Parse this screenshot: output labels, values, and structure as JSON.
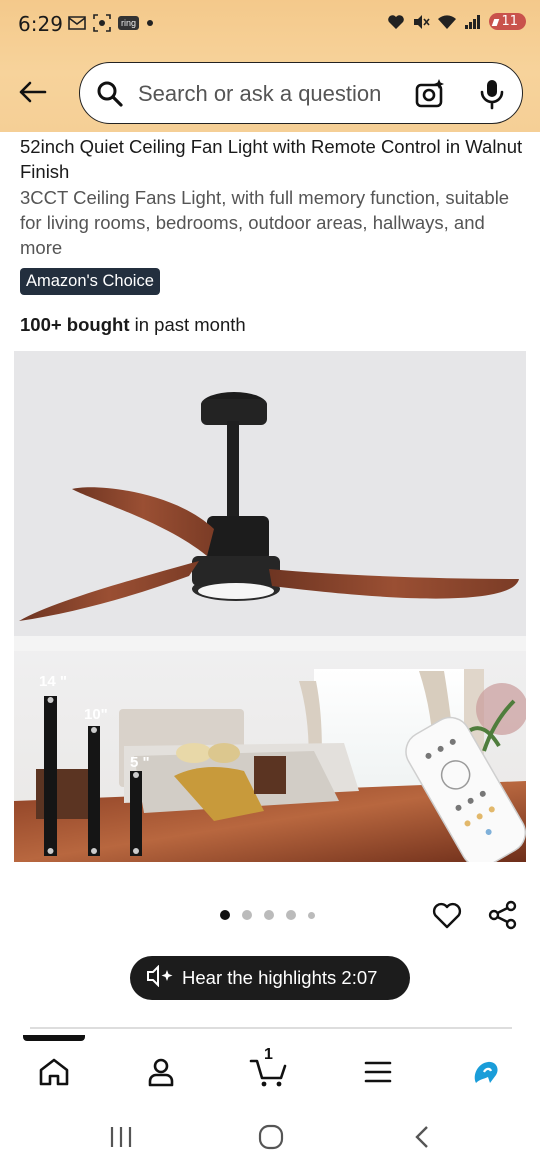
{
  "status_bar": {
    "time": "6:29",
    "ring_label": "ring",
    "battery": "11"
  },
  "search": {
    "placeholder": "Search or ask a question"
  },
  "product": {
    "title": "52inch Quiet Ceiling Fan Light with Remote Control in Walnut Finish",
    "subtitle": "3CCT Ceiling Fans Light, with full memory function, suitable for living rooms, bedrooms, outdoor areas, hallways, and more",
    "badge": "Amazon's Choice",
    "bought_bold": "100+ bought",
    "bought_rest": " in past month",
    "image": {
      "rod_labels": [
        "14 \"",
        "10\"",
        "5 \""
      ]
    },
    "image_count": 5,
    "active_image_index": 0
  },
  "audio": {
    "label": "Hear the highlights 2:07"
  },
  "bottom_nav": {
    "cart_count": "1",
    "items": [
      "home-icon",
      "account-icon",
      "cart-icon",
      "menu-icon",
      "rufus-icon"
    ]
  },
  "colors": {
    "header_bg": "#f6cf95",
    "badge_bg": "#232f3e",
    "pill_bg": "#1c1c1c",
    "rufus_blue": "#1a9dd9"
  }
}
